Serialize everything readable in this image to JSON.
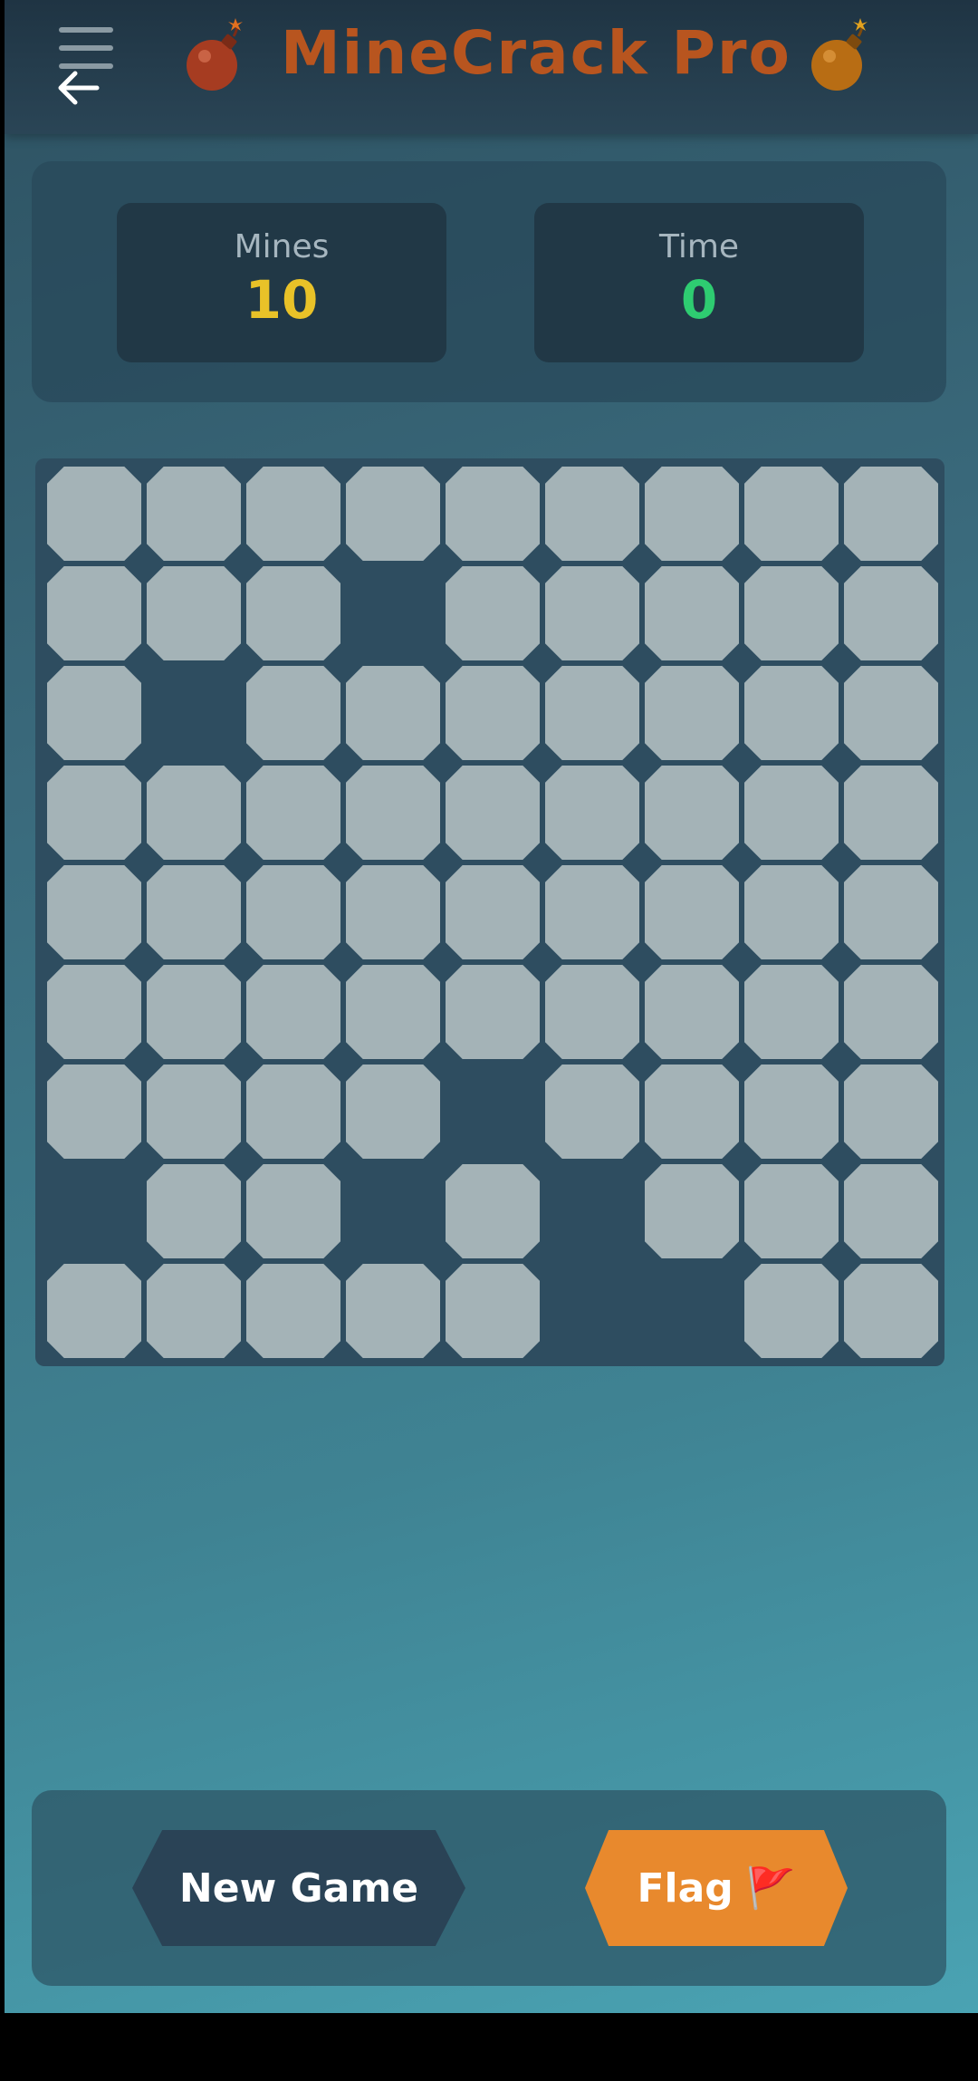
{
  "app": {
    "title": "MineCrack Pro"
  },
  "stats": {
    "mines_label": "Mines",
    "mines_value": "10",
    "time_label": "Time",
    "time_value": "0"
  },
  "board": {
    "rows": 9,
    "cols": 9,
    "revealed_empty": [
      [
        1,
        3
      ],
      [
        2,
        1
      ],
      [
        6,
        4
      ],
      [
        7,
        0
      ],
      [
        7,
        3
      ],
      [
        7,
        5
      ],
      [
        8,
        5
      ],
      [
        8,
        6
      ]
    ]
  },
  "controls": {
    "new_game_label": "New Game",
    "flag_label": "Flag",
    "flag_emoji": "🚩"
  },
  "colors": {
    "title": "#b8551f",
    "mines_value": "#e9c228",
    "time_value": "#2ecc71",
    "flag_button": "#e8892d",
    "new_game_button": "#2a4356",
    "cell": "#a4b3b7"
  },
  "icons": [
    "menu-icon",
    "back-arrow-icon",
    "bomb-icon",
    "flag-icon"
  ]
}
